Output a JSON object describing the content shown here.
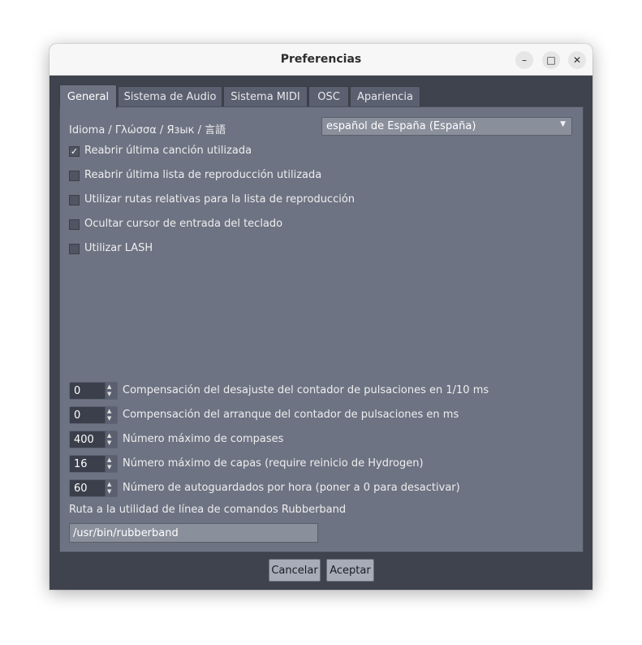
{
  "window": {
    "title": "Preferencias",
    "controls": {
      "minimize": "–",
      "maximize": "□",
      "close": "✕"
    }
  },
  "tabs": [
    {
      "label": "General",
      "active": true
    },
    {
      "label": "Sistema de Audio",
      "active": false
    },
    {
      "label": "Sistema MIDI",
      "active": false
    },
    {
      "label": "OSC",
      "active": false
    },
    {
      "label": "Apariencia",
      "active": false
    }
  ],
  "general": {
    "language_label": "Idioma / Γλώσσα / Язык / 言語",
    "language_value": "español de España (España)",
    "checkboxes": [
      {
        "label": "Reabrir última canción utilizada",
        "checked": true,
        "mark": "✓"
      },
      {
        "label": "Reabrir última lista de reproducción utilizada",
        "checked": false,
        "mark": ""
      },
      {
        "label": "Utilizar rutas relativas para la lista de reproducción",
        "checked": false,
        "mark": ""
      },
      {
        "label": "Ocultar cursor de entrada del teclado",
        "checked": false,
        "mark": ""
      },
      {
        "label": "Utilizar LASH",
        "checked": false,
        "mark": ""
      }
    ],
    "spinboxes": [
      {
        "value": "0",
        "label": "Compensación del desajuste del contador de pulsaciones en 1/10 ms"
      },
      {
        "value": "0",
        "label": "Compensación del arranque del contador de pulsaciones en ms"
      },
      {
        "value": "400",
        "label": "Número máximo de compases"
      },
      {
        "value": "16",
        "label": "Número máximo de capas (require reinicio de Hydrogen)"
      },
      {
        "value": "60",
        "label": "Número de autoguardados por hora (poner a 0 para desactivar)"
      }
    ],
    "rubberband_label": "Ruta a la utilidad de línea de comandos Rubberband",
    "rubberband_path": "/usr/bin/rubberband"
  },
  "buttons": {
    "cancel": "Cancelar",
    "ok": "Aceptar"
  },
  "colors": {
    "panel": "#6d7382",
    "window_bg": "#3f434e",
    "titlebar": "#f7f7f7"
  }
}
